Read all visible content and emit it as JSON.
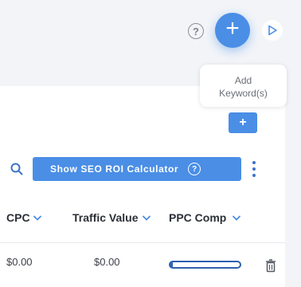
{
  "toolbar": {
    "help_label": "?",
    "add_label": "+",
    "tooltip_line1": "Add",
    "tooltip_line2": "Keyword(s)"
  },
  "card": {
    "small_add_label": "+",
    "seo_button_label": "Show SEO ROI Calculator",
    "seo_button_help": "?"
  },
  "table": {
    "headers": [
      "CPC",
      "Traffic Value",
      "PPC Comp"
    ],
    "rows": [
      {
        "cpc": "$0.00",
        "traffic_value": "$0.00",
        "ppc_comp": 0.03
      }
    ]
  },
  "colors": {
    "accent": "#4a8ee6",
    "dark_accent": "#2f5fae",
    "background": "#f2f4f8"
  },
  "icons": [
    "help-icon",
    "plus-icon",
    "play-icon",
    "search-icon",
    "more-vertical-icon",
    "chevron-down-icon",
    "trash-icon"
  ]
}
